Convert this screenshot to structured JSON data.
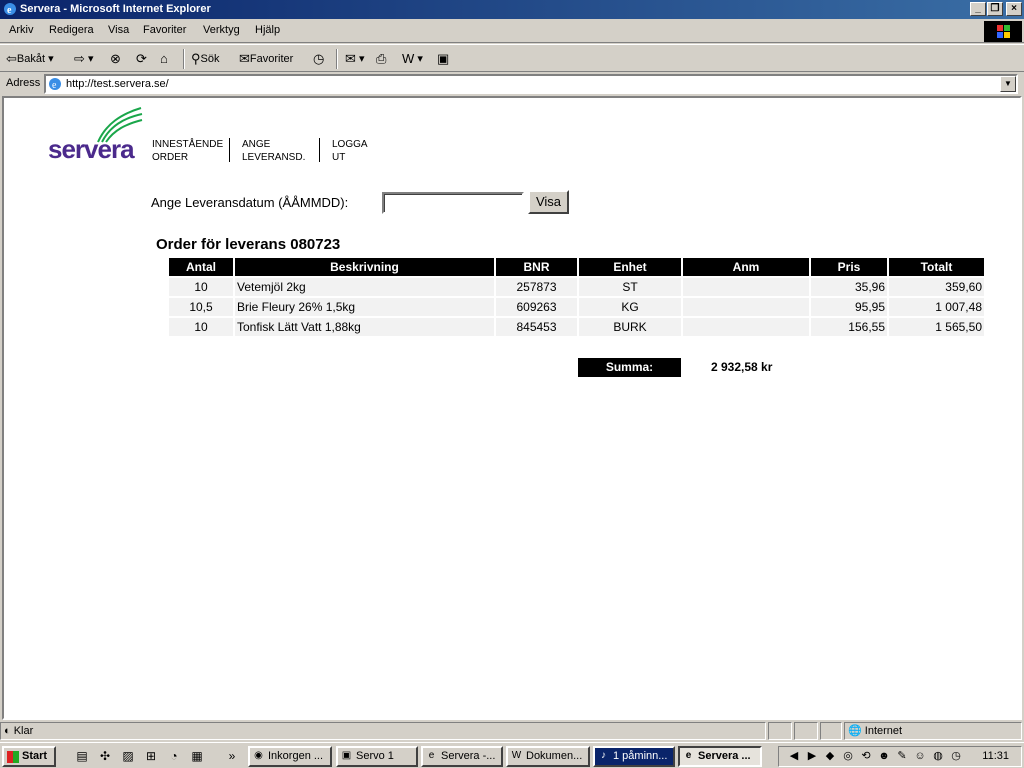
{
  "window": {
    "title": "Servera - Microsoft Internet Explorer",
    "controls": [
      "_",
      "❐",
      "×"
    ]
  },
  "menu": [
    "Arkiv",
    "Redigera",
    "Visa",
    "Favoriter",
    "Verktyg",
    "Hjälp"
  ],
  "toolbar": {
    "back": "Bakåt",
    "search": "Sök",
    "favorites": "Favoriter"
  },
  "address": {
    "label": "Adress",
    "url": "http://test.servera.se/"
  },
  "page": {
    "logo": "servera",
    "nav": [
      {
        "line1": "INNESTÅENDE",
        "line2": "ORDER"
      },
      {
        "line1": "ANGE",
        "line2": "LEVERANSD."
      },
      {
        "line1": "LOGGA",
        "line2": "UT"
      }
    ],
    "date_label": "Ange Leveransdatum (ÅÅMMDD):",
    "date_value": "",
    "visa_button": "Visa",
    "order_title": "Order för leverans 080723",
    "columns": [
      "Antal",
      "Beskrivning",
      "BNR",
      "Enhet",
      "Anm",
      "Pris",
      "Totalt"
    ],
    "rows": [
      [
        "10",
        "Vetemjöl 2kg",
        "257873",
        "ST",
        "",
        "35,96",
        "359,60"
      ],
      [
        "10,5",
        "Brie Fleury 26% 1,5kg",
        "609263",
        "KG",
        "",
        "95,95",
        "1 007,48"
      ],
      [
        "10",
        "Tonfisk Lätt Vatt 1,88kg",
        "845453",
        "BURK",
        "",
        "156,55",
        "1 565,50"
      ]
    ],
    "summa_label": "Summa:",
    "summa_value": "2 932,58 kr"
  },
  "status": {
    "text": "Klar",
    "zone": "Internet"
  },
  "taskbar": {
    "start": "Start",
    "tasks": [
      "Inkorgen ...",
      "Servo 1",
      "Servera -...",
      "Dokumen...",
      "1 påminn...",
      "Servera ..."
    ],
    "clock": "11:31"
  },
  "colors": {
    "title_bar": "#0a246a",
    "logo_purple": "#4b2a8c",
    "logo_green": "#1aa64a",
    "table_header": "#000000",
    "table_row": "#f2f2f2"
  }
}
